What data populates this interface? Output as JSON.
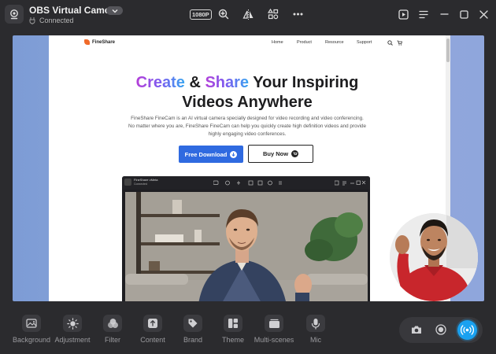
{
  "app": {
    "camera_name": "OBS Virtual Camera",
    "status": "Connected",
    "resolution_badge": "1080P"
  },
  "website": {
    "brand": "FineShare",
    "nav_links": [
      "Home",
      "Product",
      "Resource",
      "Support"
    ],
    "hero_title_part1": "Create",
    "hero_title_amp": " & ",
    "hero_title_part2": "Share",
    "hero_title_rest": " Your Inspiring",
    "hero_title_line2": "Videos Anywhere",
    "hero_sub_line1": "FineShare FineCam is an AI virtual camera specially designed for video recording and video conferencing.",
    "hero_sub_line2": "No matter where you are, FineShare FineCam can help you quickly create high definition videos and provide",
    "hero_sub_line3": "highly engaging video conferences.",
    "download_btn": "Free Download",
    "buy_btn": "Buy Now",
    "inner_app_title": "FineShare vMeta",
    "inner_app_status": "Connected"
  },
  "toolbar": {
    "items": [
      {
        "label": "Background",
        "icon": "image-icon"
      },
      {
        "label": "Adjustment",
        "icon": "brightness-icon"
      },
      {
        "label": "Filter",
        "icon": "filter-icon"
      },
      {
        "label": "Content",
        "icon": "upload-icon"
      },
      {
        "label": "Brand",
        "icon": "tag-icon"
      },
      {
        "label": "Theme",
        "icon": "theme-icon"
      },
      {
        "label": "Multi-scenes",
        "icon": "scenes-icon"
      },
      {
        "label": "Mic",
        "icon": "mic-icon"
      }
    ]
  },
  "colors": {
    "accent": "#1aa1f0",
    "download_button": "#2f6ae0",
    "brand_orange": "#f06a2a",
    "background": "#2b2b2e"
  }
}
